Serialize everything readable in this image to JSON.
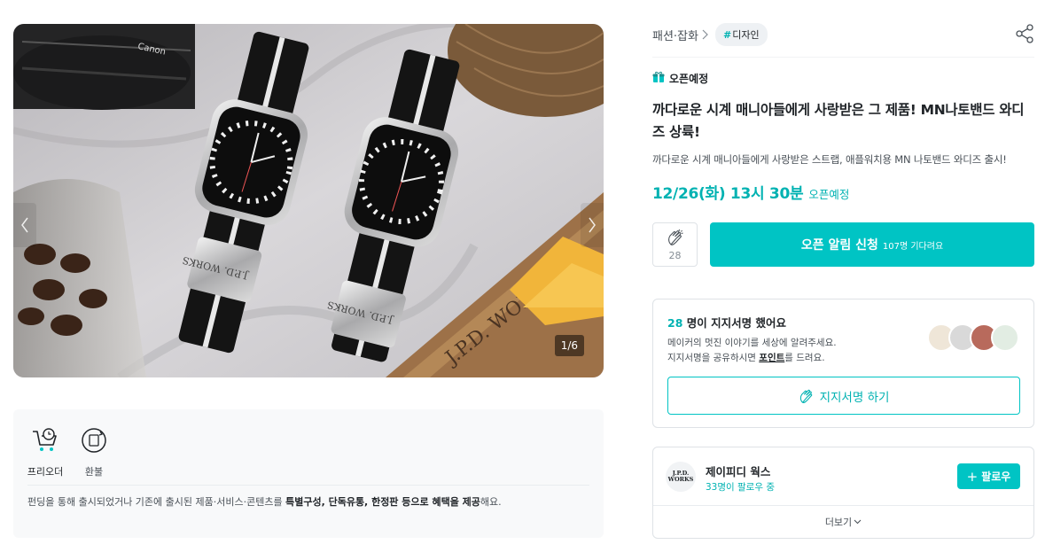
{
  "gallery": {
    "counter": "1/6",
    "image_alt": "Two silver smartwatches with black and white nylon MN straps on a table"
  },
  "info": {
    "badges": [
      {
        "label": "프리오더",
        "icon": "cart-clock-icon"
      },
      {
        "label": "환불",
        "icon": "refund-icon"
      }
    ],
    "notice_prefix": "펀딩을 통해 출시되었거나 기존에 출시된 제품·서비스·콘텐츠를 ",
    "notice_bold1": "특별구성, 단독유통, 한정판 등으로 혜택을 제공",
    "notice_suffix": "해요."
  },
  "header": {
    "category": "패션·잡화",
    "tag_hash": "#",
    "tag_label": "디자인"
  },
  "status": {
    "label": "오픈예정"
  },
  "product": {
    "title": "까다로운 시계 매니아들에게 사랑받은 그 제품! MN나토밴드 와디즈 상륙!",
    "subtitle": "까다로운 시계 매니아들에게 사랑받은 스트랩, 애플워치용 MN 나토밴드 와디즈 출시!",
    "open_date": "12/26(화) 13시 30분",
    "open_suffix": "오픈예정"
  },
  "actions": {
    "cheer_count": "28",
    "notify_label": "오픈 알림 신청",
    "notify_waiting": "107명 기다려요"
  },
  "support": {
    "count": "28",
    "heading_suffix": " 명이 지지서명 했어요",
    "desc1": "메이커의 멋진 이야기를 세상에 알려주세요.",
    "desc2_prefix": "지지서명을 공유하시면 ",
    "desc2_bold": "포인트",
    "desc2_suffix": "를 드려요.",
    "button_label": "지지서명 하기"
  },
  "maker": {
    "logo_line1": "J.P.D.",
    "logo_line2": "WORKS",
    "name": "제이피디 웍스",
    "followers": "33명이 팔로우 중",
    "follow_label": "팔로우",
    "follow_plus": "+",
    "more_label": "더보기"
  },
  "colors": {
    "accent": "#00c4c4",
    "accent_text": "#00b2b2",
    "border": "#dee2e6"
  }
}
